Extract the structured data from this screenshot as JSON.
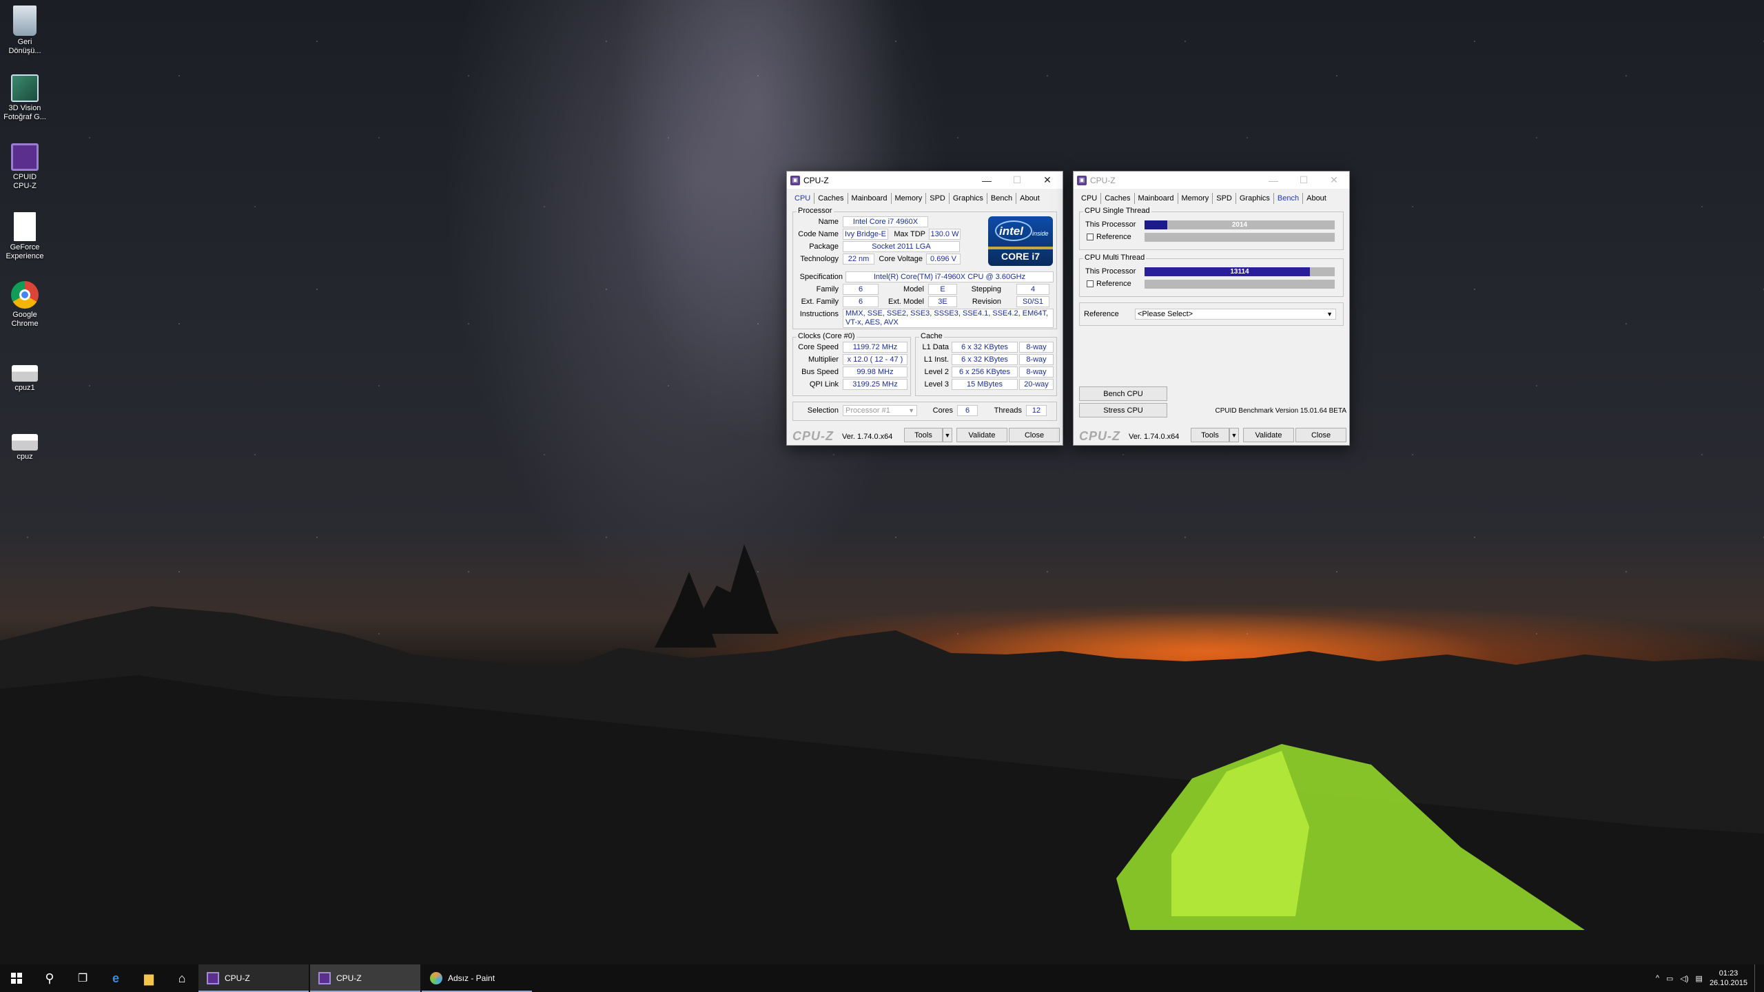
{
  "desktop": {
    "icons": [
      {
        "label": "Geri Dönüşü...",
        "icon": "recycle-bin-icon"
      },
      {
        "label": "3D Vision Fotoğraf G...",
        "icon": "3d-vision-icon"
      },
      {
        "label": "CPUID CPU-Z",
        "icon": "cpuz-icon"
      },
      {
        "label": "GeForce Experience",
        "icon": "document-icon"
      },
      {
        "label": "Google Chrome",
        "icon": "chrome-icon"
      },
      {
        "label": "cpuz1",
        "icon": "cpuz-folder-icon"
      },
      {
        "label": "cpuz",
        "icon": "cpuz-folder-icon"
      }
    ]
  },
  "window1": {
    "title": "CPU-Z",
    "tabs": [
      "CPU",
      "Caches",
      "Mainboard",
      "Memory",
      "SPD",
      "Graphics",
      "Bench",
      "About"
    ],
    "active_tab": "CPU",
    "processor": {
      "section": "Processor",
      "name_label": "Name",
      "name": "Intel Core i7 4960X",
      "codename_label": "Code Name",
      "codename": "Ivy Bridge-E",
      "maxtdp_label": "Max TDP",
      "maxtdp": "130.0 W",
      "package_label": "Package",
      "package": "Socket 2011 LGA",
      "technology_label": "Technology",
      "technology": "22 nm",
      "voltage_label": "Core Voltage",
      "voltage": "0.696 V",
      "spec_label": "Specification",
      "spec": "Intel(R) Core(TM) i7-4960X CPU @ 3.60GHz",
      "family_label": "Family",
      "family": "6",
      "model_label": "Model",
      "model": "E",
      "stepping_label": "Stepping",
      "stepping": "4",
      "extfamily_label": "Ext. Family",
      "extfamily": "6",
      "extmodel_label": "Ext. Model",
      "extmodel": "3E",
      "revision_label": "Revision",
      "revision": "S0/S1",
      "instructions_label": "Instructions",
      "instructions": "MMX, SSE, SSE2, SSE3, SSSE3, SSE4.1, SSE4.2, EM64T, VT-x, AES, AVX",
      "logo_brand": "intel",
      "logo_inside": "inside",
      "logo_core": "CORE i7"
    },
    "clocks": {
      "section": "Clocks (Core #0)",
      "corespeed_label": "Core Speed",
      "corespeed": "1199.72 MHz",
      "multiplier_label": "Multiplier",
      "multiplier": "x 12.0 ( 12 - 47 )",
      "busspeed_label": "Bus Speed",
      "busspeed": "99.98 MHz",
      "qpi_label": "QPI Link",
      "qpi": "3199.25 MHz"
    },
    "cache": {
      "section": "Cache",
      "l1d_label": "L1 Data",
      "l1d": "6 x 32 KBytes",
      "l1d_way": "8-way",
      "l1i_label": "L1 Inst.",
      "l1i": "6 x 32 KBytes",
      "l1i_way": "8-way",
      "l2_label": "Level 2",
      "l2": "6 x 256 KBytes",
      "l2_way": "8-way",
      "l3_label": "Level 3",
      "l3": "15 MBytes",
      "l3_way": "20-way"
    },
    "selection": {
      "label": "Selection",
      "value": "Processor #1",
      "cores_label": "Cores",
      "cores": "6",
      "threads_label": "Threads",
      "threads": "12"
    },
    "footer": {
      "logo": "CPU-Z",
      "version": "Ver. 1.74.0.x64",
      "tools": "Tools",
      "validate": "Validate",
      "close": "Close"
    }
  },
  "window2": {
    "title": "CPU-Z",
    "tabs": [
      "CPU",
      "Caches",
      "Mainboard",
      "Memory",
      "SPD",
      "Graphics",
      "Bench",
      "About"
    ],
    "active_tab": "Bench",
    "single": {
      "section": "CPU Single Thread",
      "this_label": "This Processor",
      "this_value": "2014",
      "this_fraction": 0.12,
      "ref_label": "Reference"
    },
    "multi": {
      "section": "CPU Multi Thread",
      "this_label": "This Processor",
      "this_value": "13114",
      "this_fraction": 0.87,
      "ref_label": "Reference"
    },
    "reference_label": "Reference",
    "reference_value": "<Please Select>",
    "bench_btn": "Bench CPU",
    "stress_btn": "Stress CPU",
    "bench_version": "CPUID Benchmark Version 15.01.64 BETA",
    "footer": {
      "logo": "CPU-Z",
      "version": "Ver. 1.74.0.x64",
      "tools": "Tools",
      "validate": "Validate",
      "close": "Close"
    }
  },
  "taskbar": {
    "apps": [
      {
        "label": "CPU-Z",
        "icon": "cpuz-icon"
      },
      {
        "label": "CPU-Z",
        "icon": "cpuz-icon"
      },
      {
        "label": "Adsız - Paint",
        "icon": "paint-icon"
      }
    ],
    "time": "01:23",
    "date": "26.10.2015"
  }
}
